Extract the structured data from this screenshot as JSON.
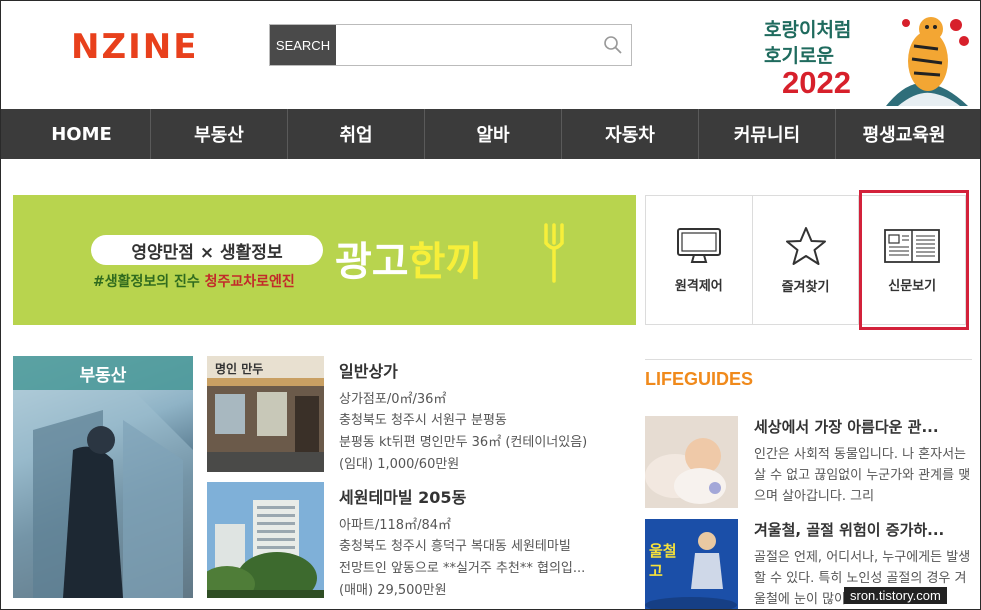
{
  "header": {
    "logo": "NZINE",
    "search_label": "SEARCH",
    "search_value": "",
    "promo": {
      "line1": "호랑이처럼",
      "line2": "호기로운",
      "year": "2022"
    }
  },
  "nav": [
    "HOME",
    "부동산",
    "취업",
    "알바",
    "자동차",
    "커뮤니티",
    "평생교육원"
  ],
  "ad": {
    "pill": "영양만점 × 생활정보",
    "sub_a": "#생활정보의 진수",
    "sub_b": "청주교차로엔진",
    "big_white": "광고",
    "big_yellow": "한끼"
  },
  "quick_menu": [
    {
      "label": "원격제어",
      "icon": "monitor-icon"
    },
    {
      "label": "즐겨찾기",
      "icon": "star-icon"
    },
    {
      "label": "신문보기",
      "icon": "newspaper-icon"
    }
  ],
  "realestate": {
    "tag": "부동산",
    "listings": [
      {
        "title": "일반상가",
        "lines": [
          "상가점포/0㎡/36㎡",
          "충청북도 청주시 서원구 분평동",
          "분평동 kt뒤편 명인만두 36㎡ (컨테이너있음)",
          "(임대) 1,000/60만원"
        ],
        "img_text": "명인 만두"
      },
      {
        "title": "세원테마빌 205동",
        "lines": [
          "아파트/118㎡/84㎡",
          "충청북도 청주시 흥덕구 복대동 세원테마빌",
          "전망트인 앞동으로 **실거주 추천** 협의입...",
          "(매매) 29,500만원"
        ]
      }
    ]
  },
  "lifeguides": {
    "heading": "LIFEGUIDES",
    "items": [
      {
        "title": "세상에서 가장 아름다운 관...",
        "text": "인간은 사회적 동물입니다. 나 혼자서는 살 수 없고 끊임없이 누군가와 관계를 맺으며 살아갑니다. 그리"
      },
      {
        "title": "겨울철, 골절 위험이 증가하...",
        "text": "골절은 언제, 어디서나, 누구에게든 발생할 수 있다. 특히 노인성 골절의 경우 겨울철에 눈이 많이 오",
        "img_text": "울철 고"
      }
    ]
  },
  "watermark": "sron.tistory.com",
  "colors": {
    "accent": "#e8401c",
    "nav_bg": "#3b3b3b",
    "ad_bg": "#b8d44e",
    "highlight": "#d3213a",
    "lifeguide": "#f08a1c"
  }
}
